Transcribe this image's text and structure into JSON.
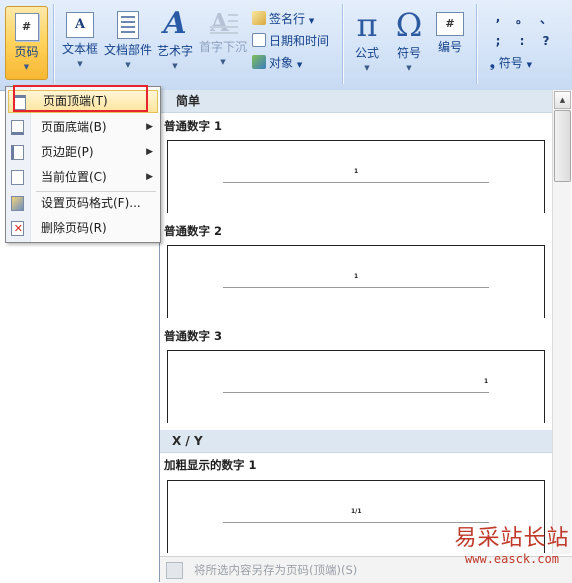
{
  "ribbon": {
    "page_number": {
      "label": "页码",
      "icon": "#"
    },
    "text_box": {
      "label": "文本框",
      "icon": "A"
    },
    "quick_parts": {
      "label": "文档部件"
    },
    "wordart": {
      "label": "艺术字",
      "icon": "A"
    },
    "drop_cap": {
      "label": "首字下沉",
      "icon": "A"
    },
    "signature_line": {
      "label": "签名行"
    },
    "date_time": {
      "label": "日期和时间"
    },
    "object": {
      "label": "对象"
    },
    "equation": {
      "label": "公式",
      "icon": "π"
    },
    "symbol": {
      "label": "符号",
      "icon": "Ω"
    },
    "numbering": {
      "label": "编号",
      "icon": "#"
    },
    "symbols_grid": [
      ",",
      "。",
      "、",
      ";",
      ":",
      "?"
    ],
    "symbol_menu": {
      "label": "符号",
      "icon": "❟"
    }
  },
  "menu": {
    "items": [
      {
        "label": "页面顶端(T)",
        "has_submenu": false
      },
      {
        "label": "页面底端(B)",
        "has_submenu": true
      },
      {
        "label": "页边距(P)",
        "has_submenu": true
      },
      {
        "label": "当前位置(C)",
        "has_submenu": true
      },
      {
        "label": "设置页码格式(F)...",
        "has_submenu": false
      },
      {
        "label": "删除页码(R)",
        "has_submenu": false
      }
    ]
  },
  "gallery": {
    "section_simple": "简单",
    "section_xy": "X / Y",
    "items": [
      {
        "title": "普通数字 1",
        "preview": "1"
      },
      {
        "title": "普通数字 2",
        "preview": "1"
      },
      {
        "title": "普通数字 3",
        "preview": "1"
      },
      {
        "title": "加粗显示的数字 1",
        "preview": "1/1"
      }
    ],
    "footer": "将所选内容另存为页码(顶端)(S)"
  },
  "watermark": {
    "cn": "易采站长站",
    "url": "www.easck.com"
  },
  "colors": {
    "highlight_border": "#e8232c",
    "menu_hover": "#ffe49c",
    "ribbon_bg": "#d5e4f7"
  }
}
